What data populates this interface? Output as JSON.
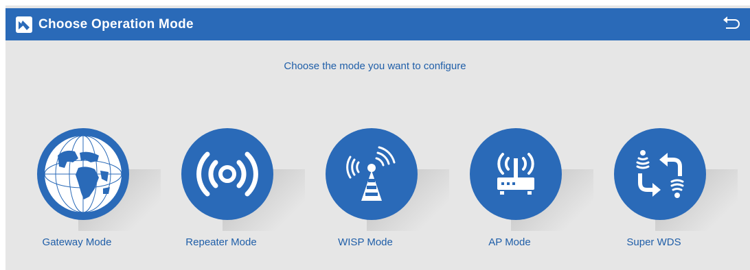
{
  "header": {
    "title": "Choose Operation Mode",
    "logo_icon": "router-logo-icon",
    "back_icon": "back-arrow-icon",
    "color": "#2a6ab8"
  },
  "subtitle": "Choose the mode you want to configure",
  "modes": [
    {
      "label": "Gateway Mode",
      "icon": "globe-icon"
    },
    {
      "label": "Repeater Mode",
      "icon": "broadcast-icon"
    },
    {
      "label": "WISP Mode",
      "icon": "antenna-tower-icon"
    },
    {
      "label": "AP Mode",
      "icon": "router-icon"
    },
    {
      "label": "Super WDS",
      "icon": "wds-exchange-icon"
    }
  ]
}
